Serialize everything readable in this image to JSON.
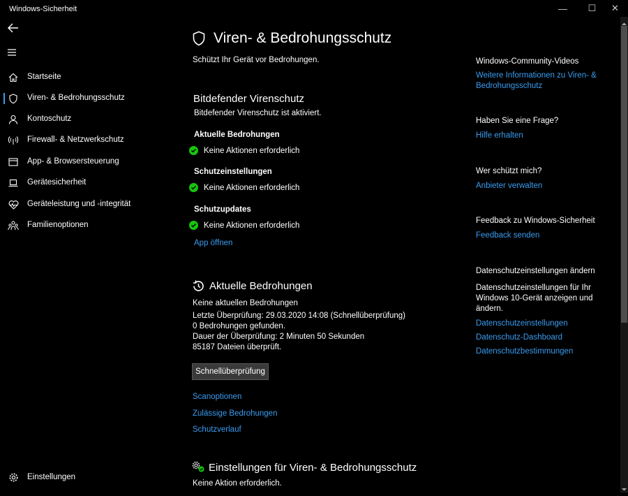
{
  "window": {
    "title": "Windows-Sicherheit",
    "minimize": "—",
    "maximize": "☐",
    "close": "✕"
  },
  "sidebar": {
    "items": [
      {
        "label": "Startseite"
      },
      {
        "label": "Viren- & Bedrohungsschutz",
        "selected": true
      },
      {
        "label": "Kontoschutz"
      },
      {
        "label": "Firewall- & Netzwerkschutz"
      },
      {
        "label": "App- & Browsersteuerung"
      },
      {
        "label": "Gerätesicherheit"
      },
      {
        "label": "Geräteleistung und -integrität"
      },
      {
        "label": "Familienoptionen"
      }
    ],
    "settings_label": "Einstellungen"
  },
  "main": {
    "title": "Viren- & Bedrohungsschutz",
    "subtitle": "Schützt Ihr Gerät vor Bedrohungen.",
    "provider": {
      "heading": "Bitdefender Virenschutz",
      "status": "Bitdefender Virenschutz ist aktiviert.",
      "groups": [
        {
          "title": "Aktuelle Bedrohungen",
          "status": "Keine Aktionen erforderlich"
        },
        {
          "title": "Schutzeinstellungen",
          "status": "Keine Aktionen erforderlich"
        },
        {
          "title": "Schutzupdates",
          "status": "Keine Aktionen erforderlich"
        }
      ],
      "open_app": "App öffnen"
    },
    "threats": {
      "heading": "Aktuelle Bedrohungen",
      "lines": [
        "Keine aktuellen Bedrohungen",
        "Letzte Überprüfung: 29.03.2020 14:08 (Schnellüberprüfung)",
        "0 Bedrohungen gefunden.",
        "Dauer der Überprüfung: 2 Minuten 50 Sekunden",
        "85187 Dateien überprüft."
      ],
      "quick_scan_button": "Schnellüberprüfung",
      "links": [
        "Scanoptionen",
        "Zulässige Bedrohungen",
        "Schutzverlauf"
      ]
    },
    "settings_section": {
      "heading": "Einstellungen für Viren- & Bedrohungsschutz",
      "status": "Keine Aktion erforderlich."
    }
  },
  "right_panel": {
    "community": {
      "heading": "Windows-Community-Videos",
      "link_line1": "Weitere Informationen zu Viren- &",
      "link_line2": "Bedrohungsschutz"
    },
    "question": {
      "heading": "Haben Sie eine Frage?",
      "link": "Hilfe erhalten"
    },
    "who": {
      "heading": "Wer schützt mich?",
      "link": "Anbieter verwalten"
    },
    "feedback": {
      "heading": "Feedback zu Windows-Sicherheit",
      "link": "Feedback senden"
    },
    "privacy": {
      "heading": "Datenschutzeinstellungen ändern",
      "text_line1": "Datenschutzeinstellungen für Ihr",
      "text_line2": "Windows 10-Gerät anzeigen und",
      "text_line3": "ändern.",
      "links": [
        "Datenschutzeinstellungen",
        "Datenschutz-Dashboard",
        "Datenschutzbestimmungen"
      ]
    }
  },
  "colors": {
    "accent": "#3a9cf0",
    "ok_green": "#16c60c",
    "background": "#000000"
  }
}
